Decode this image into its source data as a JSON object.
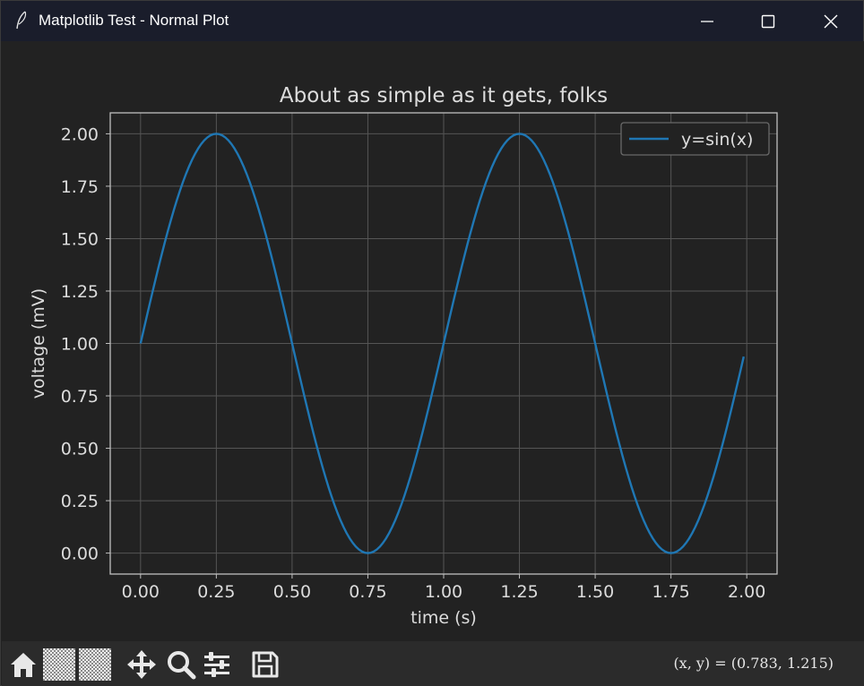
{
  "window": {
    "title": "Matplotlib Test - Normal Plot",
    "icon": "feather-icon"
  },
  "chart_data": {
    "type": "line",
    "title": "About as simple as it gets, folks",
    "xlabel": "time (s)",
    "ylabel": "voltage (mV)",
    "xlim": [
      -0.1,
      2.1
    ],
    "ylim": [
      -0.1,
      2.1
    ],
    "xticks": [
      "0.00",
      "0.25",
      "0.50",
      "0.75",
      "1.00",
      "1.25",
      "1.50",
      "1.75",
      "2.00"
    ],
    "yticks": [
      "0.00",
      "0.25",
      "0.50",
      "0.75",
      "1.00",
      "1.25",
      "1.50",
      "1.75",
      "2.00"
    ],
    "grid": true,
    "legend": "top-right",
    "series": [
      {
        "name": "y=sin(x)",
        "function": "1 + sin(2πt)",
        "x_range": [
          0.0,
          1.99
        ],
        "step": 0.01,
        "color": "#1f77b4"
      }
    ],
    "colors": {
      "background": "#222222",
      "axes": "#bfbfbf",
      "grid": "#555555",
      "text": "#dcdcdc"
    }
  },
  "toolbar": {
    "buttons": [
      "home-icon",
      "back-icon",
      "forward-icon",
      "pan-icon",
      "zoom-icon",
      "configure-subplots-icon",
      "save-icon"
    ],
    "coords_text": "(x, y) = (0.783, 1.215)"
  }
}
